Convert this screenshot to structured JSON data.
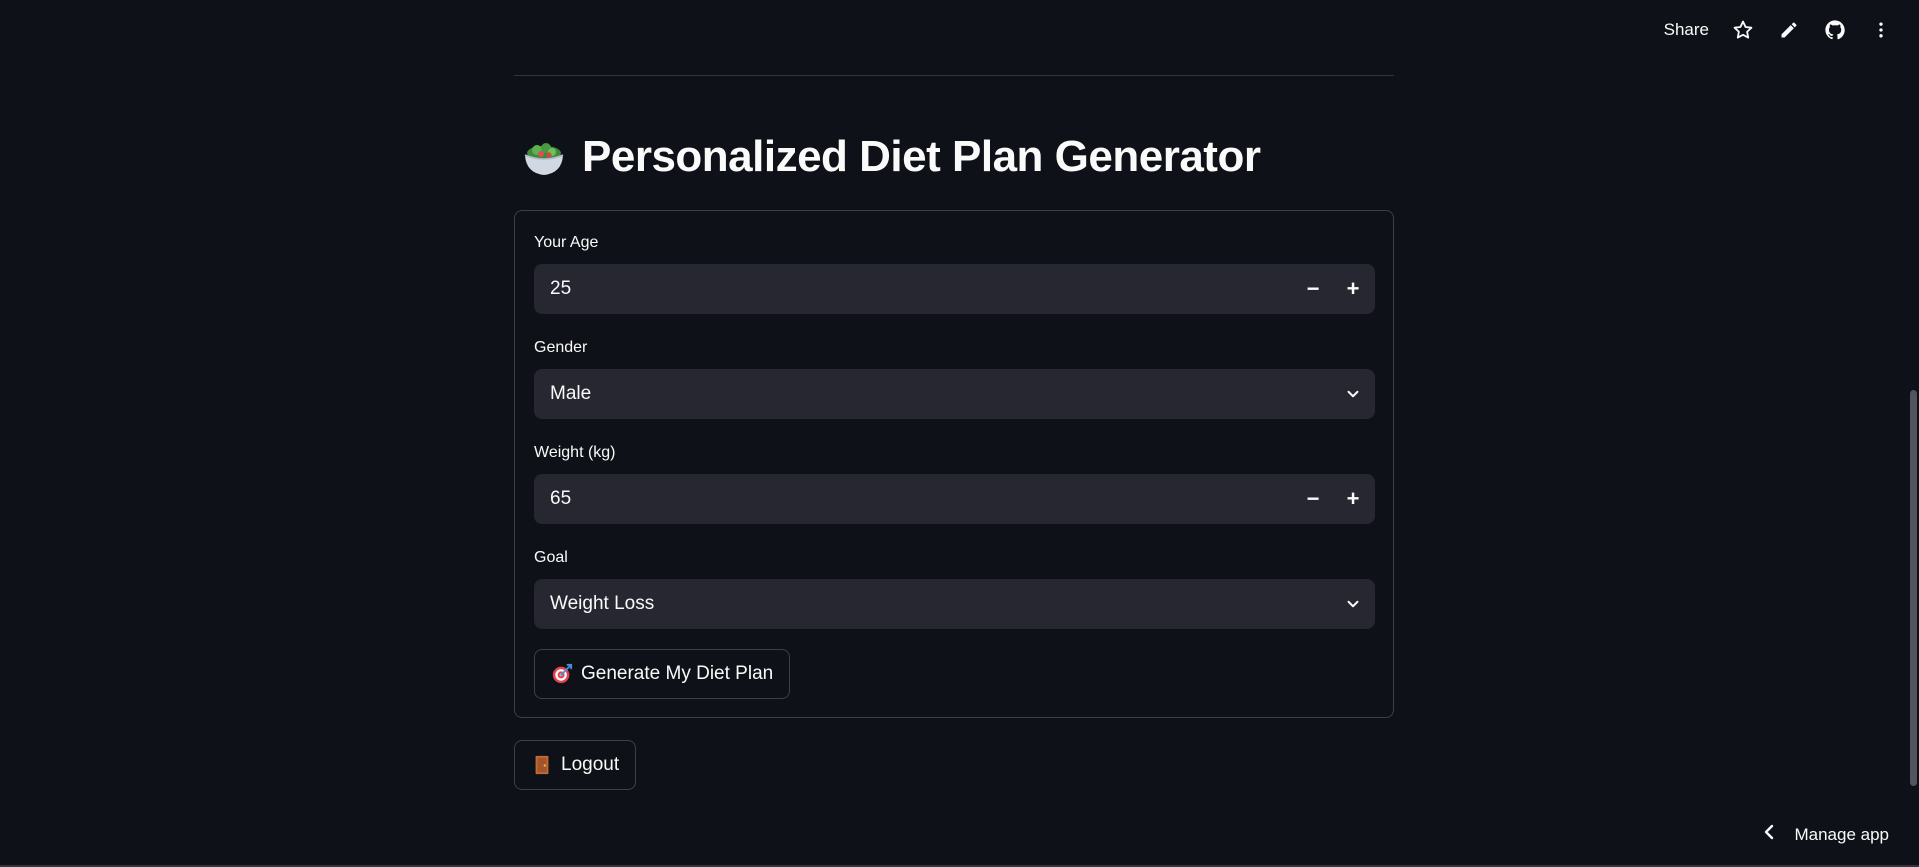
{
  "toolbar": {
    "share_label": "Share",
    "icons": [
      "star-icon",
      "pencil-icon",
      "github-icon",
      "more-vertical-icon"
    ]
  },
  "page": {
    "title": "Personalized Diet Plan Generator",
    "title_icon": "salad-bowl-icon"
  },
  "form": {
    "age": {
      "label": "Your Age",
      "value": "25",
      "minus": "−",
      "plus": "+"
    },
    "gender": {
      "label": "Gender",
      "value": "Male"
    },
    "weight": {
      "label": "Weight (kg)",
      "value": "65",
      "minus": "−",
      "plus": "+"
    },
    "goal": {
      "label": "Goal",
      "value": "Weight Loss"
    },
    "generate_button": {
      "label": "Generate My Diet Plan",
      "icon": "target-dart-icon"
    }
  },
  "logout_button": {
    "label": "Logout",
    "icon": "door-icon"
  },
  "footer": {
    "manage_app_label": "Manage app"
  },
  "colors": {
    "background": "#0e1117",
    "input_bg": "#262730",
    "border": "#3d404b",
    "text": "#fafafa"
  }
}
